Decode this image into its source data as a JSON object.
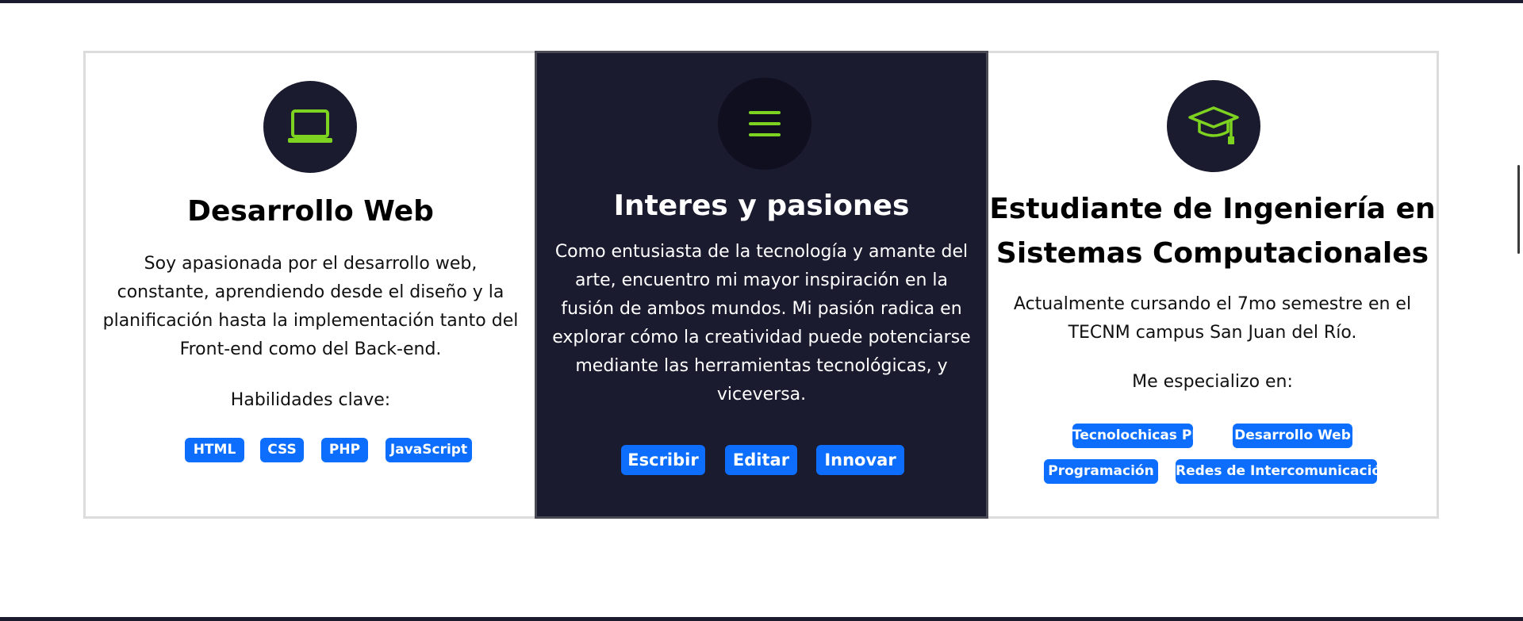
{
  "colors": {
    "dark": "#1b1b2f",
    "accent_green": "#7ed321",
    "button_blue": "#0d6efd",
    "border_gray": "#dcdcdc"
  },
  "cards": {
    "web": {
      "icon": "laptop-icon",
      "title": "Desarrollo Web",
      "text_lines": [
        "Soy apasionada por el desarrollo web,",
        "constante, aprendiendo desde el diseño y la",
        "planificación hasta la implementación tanto del",
        "Front-end como del Back-end."
      ],
      "skills_label": "Habilidades clave:",
      "skills": [
        "HTML",
        "CSS",
        "PHP",
        "JavaScript"
      ]
    },
    "passions": {
      "icon": "menu-icon",
      "title": "Interes y pasiones",
      "text_lines": [
        "Como entusiasta de la tecnología y amante del",
        "arte, encuentro mi mayor inspiración en la",
        "fusión de ambos mundos. Mi pasión radica en",
        "explorar cómo la creatividad puede potenciarse",
        "mediante las herramientas tecnológicas, y",
        "viceversa."
      ],
      "buttons": [
        "Escribir",
        "Editar",
        "Innovar"
      ]
    },
    "student": {
      "icon": "graduation-cap-icon",
      "title_lines": [
        "Estudiante de Ingeniería en",
        "Sistemas Computacionales"
      ],
      "text_lines": [
        "Actualmente cursando el 7mo semestre en el",
        "TECNM campus San Juan del Río."
      ],
      "specialty_label": "Me especializo en:",
      "specialties": [
        "Tecnolochicas PRO",
        "Desarrollo Web",
        "Programación",
        "Redes de Intercomunicación"
      ]
    }
  }
}
